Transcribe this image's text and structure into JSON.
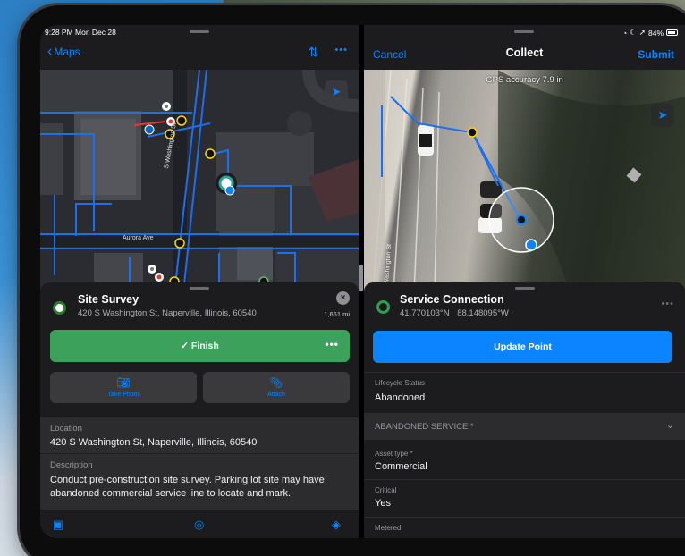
{
  "left": {
    "status": {
      "time": "9:28 PM  Mon Dec 28"
    },
    "nav": {
      "back_label": "Maps",
      "sort_icon": "sort-icon",
      "more_icon": "more-icon"
    },
    "map": {
      "street_1": "S Washington St",
      "street_2": "Aurora Ave",
      "street_3": "S Washington St"
    },
    "feature": {
      "title": "Site Survey",
      "address": "420 S Washington St, Naperville, Illinois, 60540",
      "distance": "1,661 mi",
      "close": "×"
    },
    "actions": {
      "finish_label": "✓ Finish",
      "more": "•••",
      "take_photo_label": "Take Photo",
      "attach_label": "Attach"
    },
    "details": [
      {
        "label": "Location",
        "value": "420 S Washington St, Naperville, Illinois, 60540"
      },
      {
        "label": "Description",
        "value": "Conduct pre-construction site survey. Parking lot site may have abandoned commercial service line to locate and mark."
      }
    ]
  },
  "right": {
    "status": {
      "battery": "84%"
    },
    "nav": {
      "cancel_label": "Cancel",
      "title": "Collect",
      "submit_label": "Submit"
    },
    "map": {
      "gps_accuracy": "GPS accuracy 7.9 in",
      "street": "Washington St"
    },
    "feature": {
      "title": "Service Connection",
      "lat": "41.770103°N",
      "lon": "88.148095°W",
      "more": "•••"
    },
    "update_label": "Update Point",
    "form": {
      "lifecycle": {
        "label": "Lifecycle Status",
        "value": "Abandoned"
      },
      "group_title": "ABANDONED SERVICE *",
      "asset_type": {
        "label": "Asset type *",
        "value": "Commercial"
      },
      "critical": {
        "label": "Critical",
        "value": "Yes"
      },
      "metered": {
        "label": "Metered"
      }
    }
  },
  "colors": {
    "accent": "#0a84ff",
    "finish": "#3ca15a",
    "dark_bg": "#1c1c1e",
    "field_bg": "#2c2c2e"
  }
}
